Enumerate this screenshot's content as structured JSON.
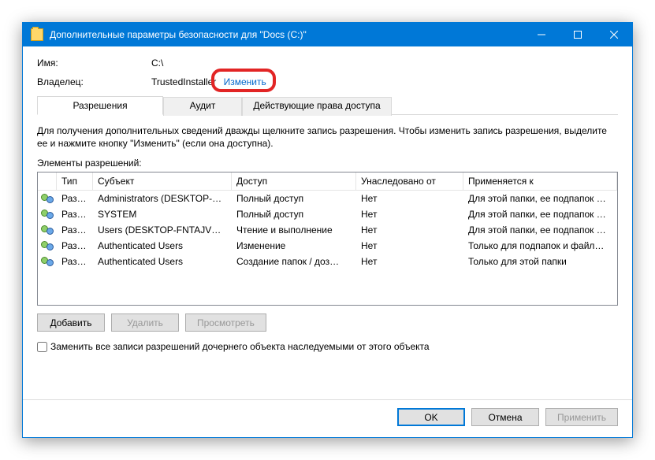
{
  "window": {
    "title": "Дополнительные параметры безопасности  для \"Docs (C:)\""
  },
  "info": {
    "nameLabel": "Имя:",
    "nameValue": "C:\\",
    "ownerLabel": "Владелец:",
    "ownerValue": "TrustedInstaller",
    "changeLink": "Изменить"
  },
  "tabs": {
    "permissions": "Разрешения",
    "audit": "Аудит",
    "effective": "Действующие права доступа"
  },
  "help": "Для получения дополнительных сведений дважды щелкните запись разрешения. Чтобы изменить запись разрешения, выделите ее и нажмите кнопку \"Изменить\" (если она доступна).",
  "elementsLabel": "Элементы разрешений:",
  "columns": {
    "type": "Тип",
    "subject": "Субъект",
    "access": "Доступ",
    "inherited": "Унаследовано от",
    "applies": "Применяется к"
  },
  "rows": [
    {
      "type": "Разр…",
      "subject": "Administrators (DESKTOP-FN…",
      "access": "Полный доступ",
      "inherited": "Нет",
      "applies": "Для этой папки, ее подпапок …"
    },
    {
      "type": "Разр…",
      "subject": "SYSTEM",
      "access": "Полный доступ",
      "inherited": "Нет",
      "applies": "Для этой папки, ее подпапок …"
    },
    {
      "type": "Разр…",
      "subject": "Users (DESKTOP-FNTAJVG\\Us…",
      "access": "Чтение и выполнение",
      "inherited": "Нет",
      "applies": "Для этой папки, ее подпапок …"
    },
    {
      "type": "Разр…",
      "subject": "Authenticated Users",
      "access": "Изменение",
      "inherited": "Нет",
      "applies": "Только для подпапок и файл…"
    },
    {
      "type": "Разр…",
      "subject": "Authenticated Users",
      "access": "Создание папок / доз…",
      "inherited": "Нет",
      "applies": "Только для этой папки"
    }
  ],
  "buttons": {
    "add": "Добавить",
    "remove": "Удалить",
    "view": "Просмотреть"
  },
  "checkbox": "Заменить все записи разрешений дочернего объекта наследуемыми от этого объекта",
  "footer": {
    "ok": "OK",
    "cancel": "Отмена",
    "apply": "Применить"
  }
}
